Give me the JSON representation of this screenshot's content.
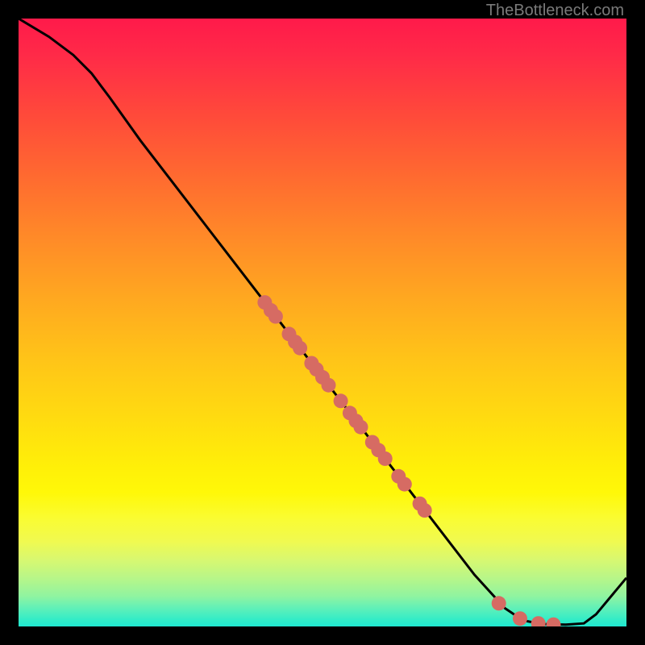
{
  "attribution": "TheBottleneck.com",
  "chart_data": {
    "type": "line",
    "title": "",
    "xlabel": "",
    "ylabel": "",
    "xlim": [
      0,
      100
    ],
    "ylim": [
      0,
      100
    ],
    "curve": [
      {
        "x": 0,
        "y": 100
      },
      {
        "x": 5,
        "y": 97
      },
      {
        "x": 9,
        "y": 94
      },
      {
        "x": 12,
        "y": 91
      },
      {
        "x": 15,
        "y": 87
      },
      {
        "x": 20,
        "y": 80
      },
      {
        "x": 25,
        "y": 73.5
      },
      {
        "x": 30,
        "y": 67
      },
      {
        "x": 35,
        "y": 60.5
      },
      {
        "x": 40,
        "y": 54
      },
      {
        "x": 45,
        "y": 47.5
      },
      {
        "x": 50,
        "y": 41
      },
      {
        "x": 55,
        "y": 34.5
      },
      {
        "x": 60,
        "y": 28
      },
      {
        "x": 65,
        "y": 21.5
      },
      {
        "x": 70,
        "y": 15
      },
      {
        "x": 75,
        "y": 8.5
      },
      {
        "x": 80,
        "y": 3
      },
      {
        "x": 83,
        "y": 1
      },
      {
        "x": 86,
        "y": 0.4
      },
      {
        "x": 90,
        "y": 0.3
      },
      {
        "x": 93,
        "y": 0.5
      },
      {
        "x": 95,
        "y": 2
      },
      {
        "x": 100,
        "y": 8
      }
    ],
    "markers": [
      {
        "x": 40.5,
        "y": 53.3
      },
      {
        "x": 41.5,
        "y": 52.0
      },
      {
        "x": 42.3,
        "y": 51.0
      },
      {
        "x": 44.5,
        "y": 48.1
      },
      {
        "x": 45.5,
        "y": 46.8
      },
      {
        "x": 46.3,
        "y": 45.8
      },
      {
        "x": 48.2,
        "y": 43.3
      },
      {
        "x": 49.0,
        "y": 42.3
      },
      {
        "x": 50.0,
        "y": 41.0
      },
      {
        "x": 51.0,
        "y": 39.7
      },
      {
        "x": 53.0,
        "y": 37.1
      },
      {
        "x": 54.5,
        "y": 35.1
      },
      {
        "x": 55.5,
        "y": 33.8
      },
      {
        "x": 56.3,
        "y": 32.8
      },
      {
        "x": 58.2,
        "y": 30.3
      },
      {
        "x": 59.2,
        "y": 29.0
      },
      {
        "x": 60.3,
        "y": 27.6
      },
      {
        "x": 62.5,
        "y": 24.7
      },
      {
        "x": 63.5,
        "y": 23.4
      },
      {
        "x": 66.0,
        "y": 20.2
      },
      {
        "x": 66.8,
        "y": 19.1
      },
      {
        "x": 79.0,
        "y": 3.8
      },
      {
        "x": 82.5,
        "y": 1.3
      },
      {
        "x": 85.5,
        "y": 0.5
      },
      {
        "x": 88.0,
        "y": 0.3
      }
    ],
    "marker_color": "#d66b63",
    "line_color": "#000000"
  }
}
